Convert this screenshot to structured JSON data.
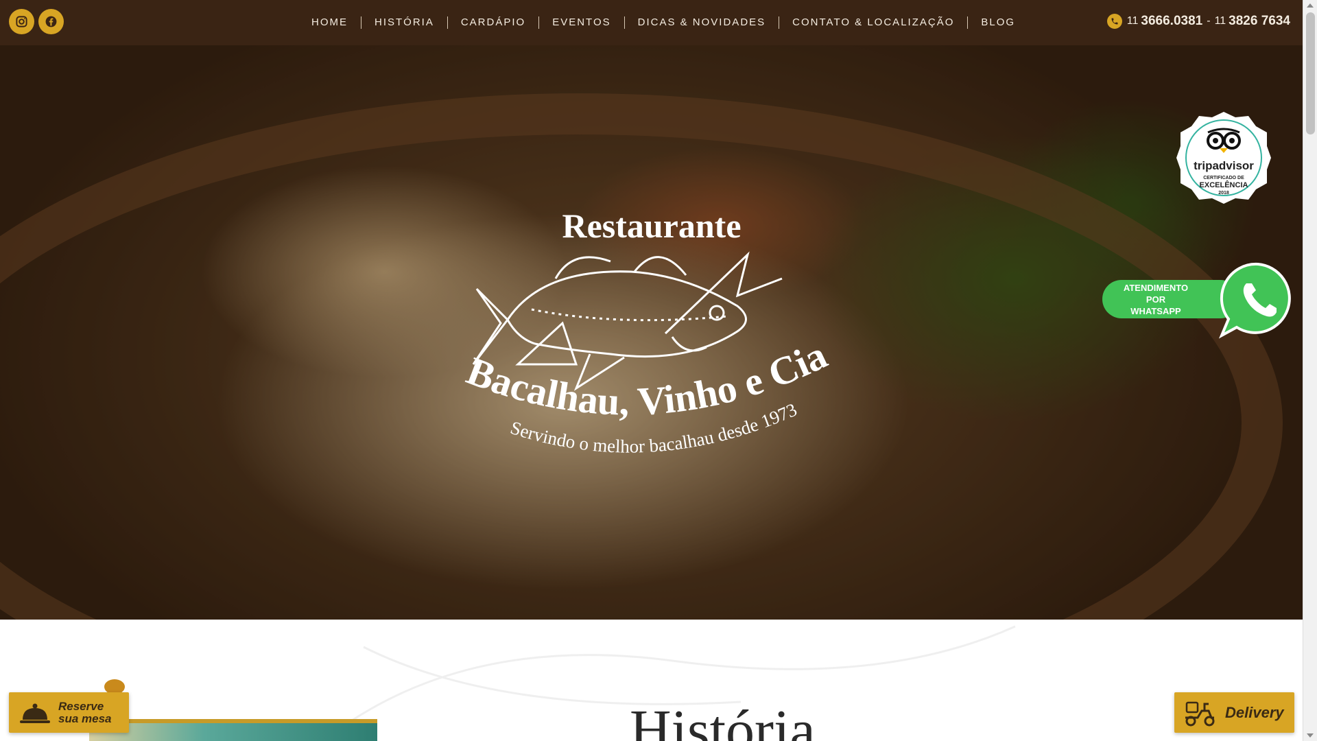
{
  "header": {
    "social": [
      {
        "icon": "instagram-icon"
      },
      {
        "icon": "facebook-icon"
      }
    ],
    "nav": [
      "HOME",
      "HISTÓRIA",
      "CARDÁPIO",
      "EVENTOS",
      "DICAS & NOVIDADES",
      "CONTATO & LOCALIZAÇÃO",
      "BLOG"
    ],
    "phone": {
      "area1": "11",
      "number1": "3666.0381",
      "separator": "-",
      "area2": "11",
      "number2": "3826 7634"
    }
  },
  "hero": {
    "logo": {
      "top_text": "Restaurante",
      "name": "Bacalhau, Vinho e Cia.",
      "tagline": "Servindo o melhor bacalhau desde 1973"
    },
    "tripadvisor": {
      "brand": "tripadvisor",
      "line1": "CERTIFICADO DE",
      "line2": "EXCELÊNCIA",
      "year": "2018"
    },
    "whatsapp": {
      "line1": "ATENDIMENTO",
      "line2": "POR",
      "line3": "WHATSAPP"
    }
  },
  "section": {
    "title": "História"
  },
  "floating": {
    "reserve_line1": "Reserve",
    "reserve_line2": "sua mesa",
    "delivery": "Delivery"
  },
  "colors": {
    "header_bg": "#3a2414",
    "accent": "#d8a524",
    "whatsapp": "#41c356"
  }
}
